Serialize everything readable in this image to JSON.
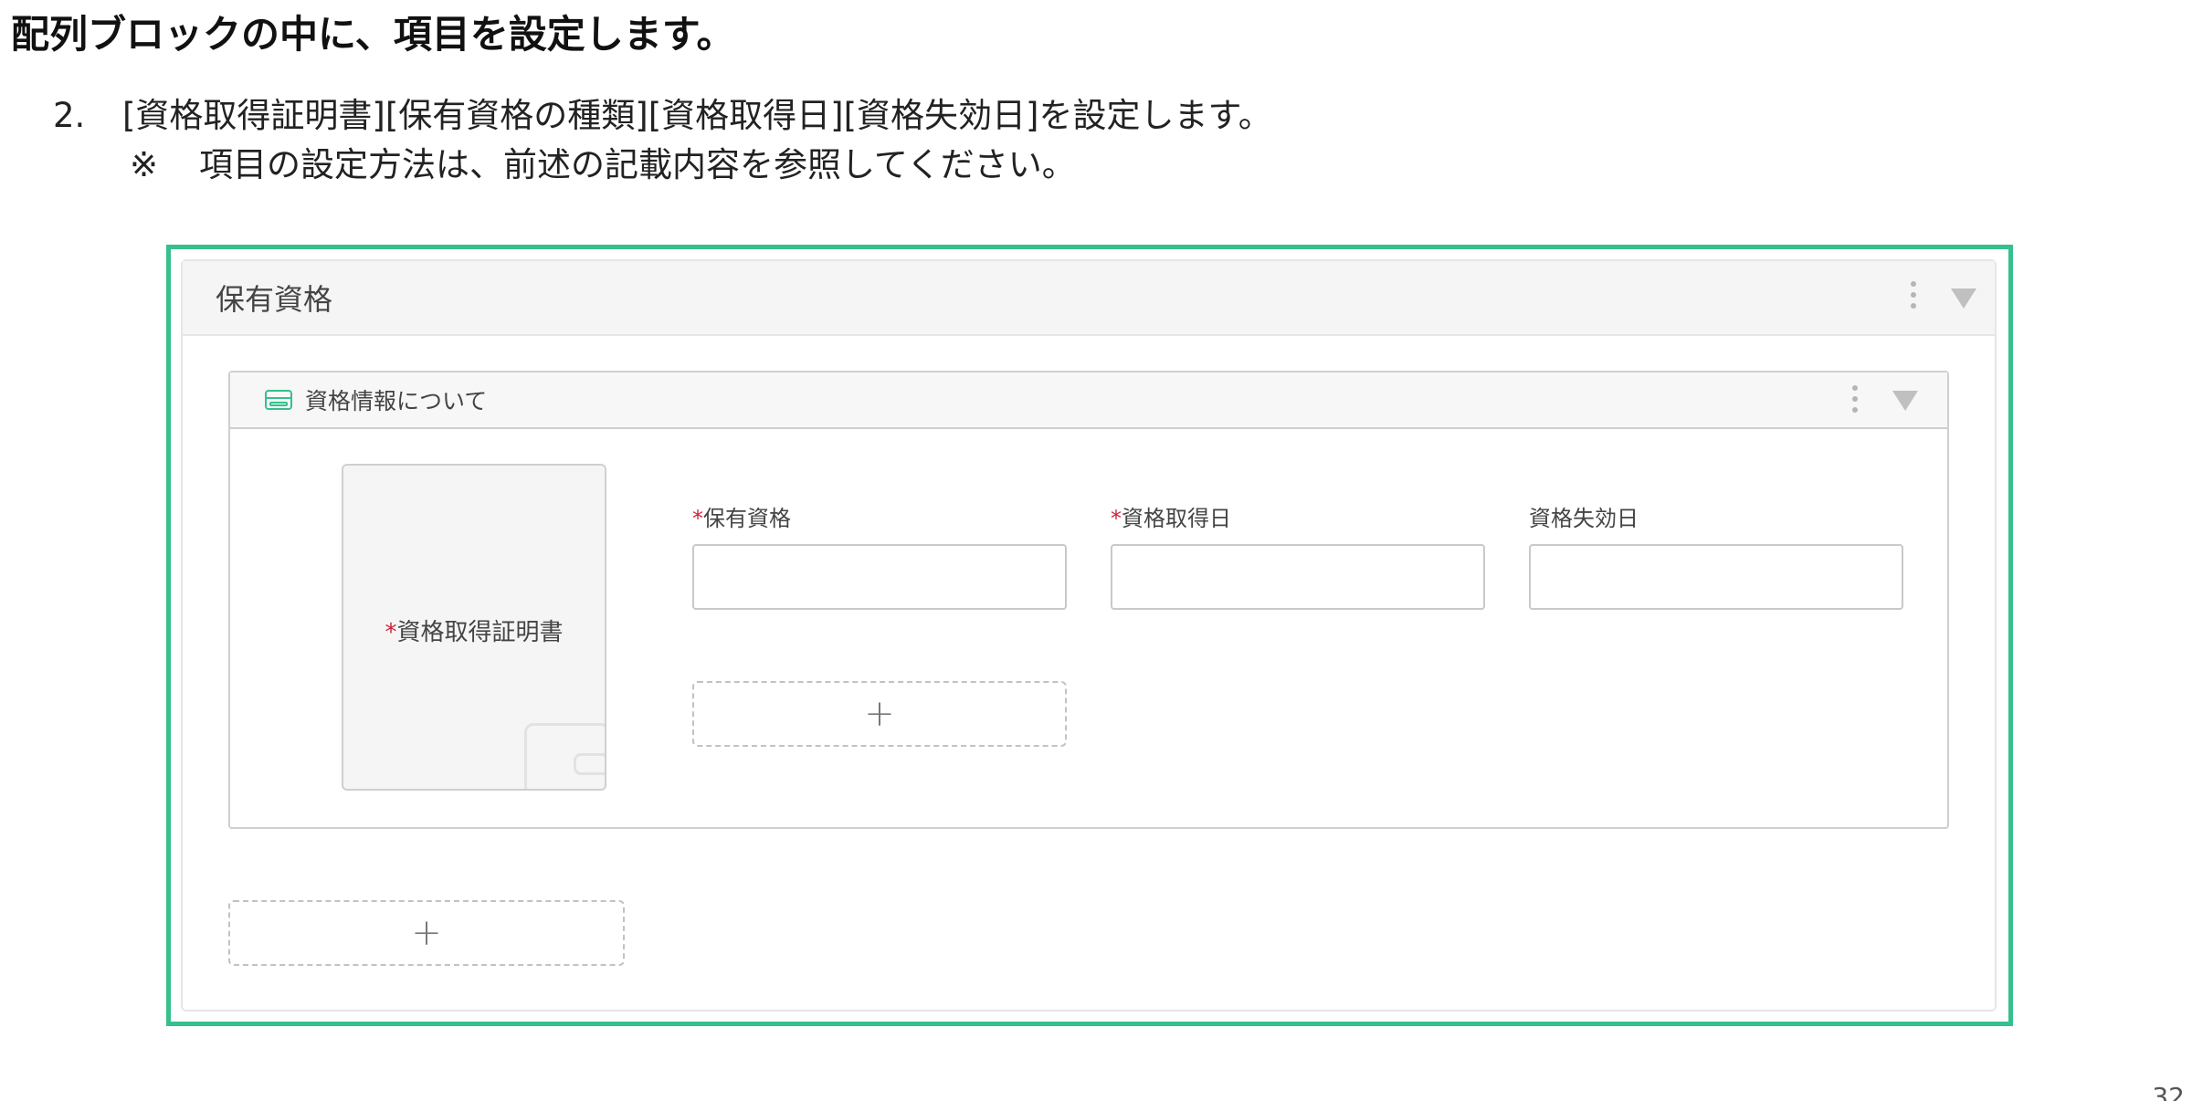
{
  "page": {
    "heading": "配列ブロックの中に、項目を設定します。",
    "instruction": {
      "number": "2.",
      "text": "[資格取得証明書][保有資格の種類][資格取得日][資格失効日]を設定します。",
      "note_mark": "※",
      "note_text": "項目の設定方法は、前述の記載内容を参照してください。"
    },
    "page_number": "32"
  },
  "array_block": {
    "title": "保有資格",
    "add_icon": "+"
  },
  "inner_block": {
    "title": "資格情報について",
    "icon": "card-icon",
    "image_field": {
      "required_mark": "*",
      "label": "資格取得証明書",
      "icon": "wallet-icon"
    },
    "fields": [
      {
        "required_mark": "*",
        "label": "保有資格",
        "value": ""
      },
      {
        "required_mark": "*",
        "label": "資格取得日",
        "value": ""
      },
      {
        "required_mark": "",
        "label": "資格失効日",
        "value": ""
      }
    ],
    "add_icon": "+"
  },
  "colors": {
    "highlight": "#35c08c",
    "required": "#d0233a"
  }
}
